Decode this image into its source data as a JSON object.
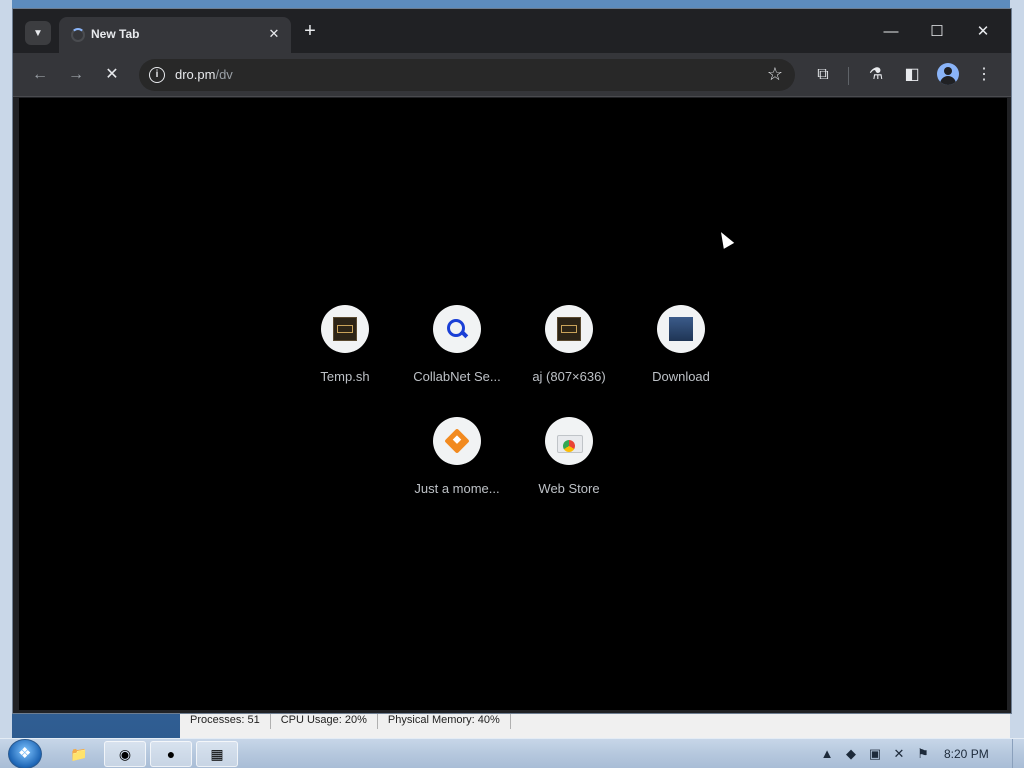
{
  "browser": {
    "tab": {
      "title": "New Tab"
    },
    "address_bar": {
      "url_host": "dro.pm",
      "url_path": "/dv"
    }
  },
  "shortcuts": [
    {
      "label": "Temp.sh",
      "icon": "temp-sh-favicon"
    },
    {
      "label": "CollabNet Se...",
      "icon": "search-favicon"
    },
    {
      "label": "aj (807×636)",
      "icon": "image-favicon"
    },
    {
      "label": "Download",
      "icon": "download-favicon"
    },
    {
      "label": "Just a mome...",
      "icon": "diamond-favicon"
    },
    {
      "label": "Web Store",
      "icon": "web-store-favicon"
    }
  ],
  "task_manager_status": {
    "processes": "Processes: 51",
    "cpu": "CPU Usage: 20%",
    "memory": "Physical Memory: 40%"
  },
  "taskbar": {
    "clock": "8:20 PM"
  },
  "colors": {
    "chrome_dark": "#202124",
    "toolbar": "#35363a",
    "content_bg": "#000000",
    "shortcut_label": "#bdc1c6"
  }
}
